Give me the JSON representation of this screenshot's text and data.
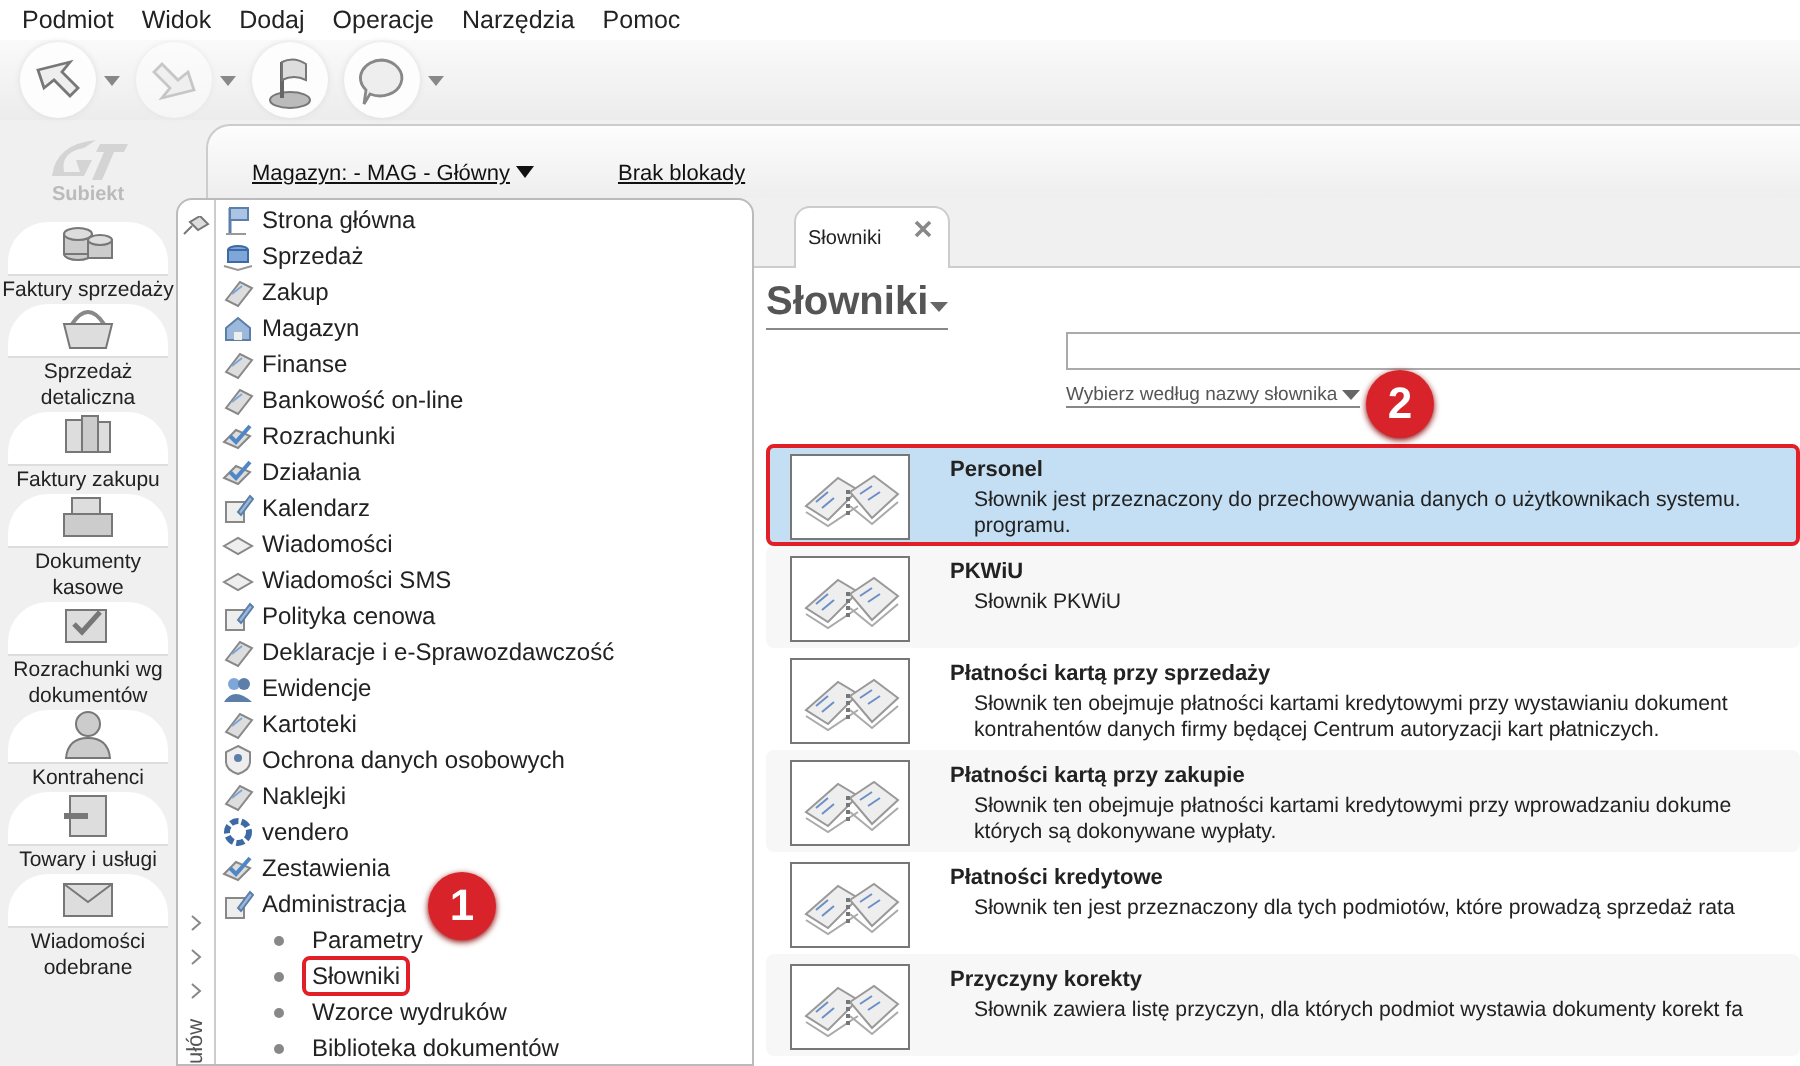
{
  "menu": [
    "Podmiot",
    "Widok",
    "Dodaj",
    "Operacje",
    "Narzędzia",
    "Pomoc"
  ],
  "toolbar": [
    {
      "has_menu": true,
      "disabled": false
    },
    {
      "has_menu": true,
      "disabled": true
    },
    {
      "has_menu": false,
      "disabled": false
    },
    {
      "has_menu": true,
      "disabled": false
    }
  ],
  "logo": {
    "text": "Subiekt"
  },
  "rail": [
    {
      "label": "Faktury sprzedaży"
    },
    {
      "label": "Sprzedaż detaliczna"
    },
    {
      "label": "Faktury zakupu"
    },
    {
      "label": "Dokumenty kasowe"
    },
    {
      "label": "Rozrachunki wg dokumentów"
    },
    {
      "label": "Kontrahenci"
    },
    {
      "label": "Towary i usługi"
    },
    {
      "label": "Wiadomości odebrane"
    }
  ],
  "header": {
    "warehouse": "Magazyn: - MAG - Główny",
    "lock": "Brak blokady"
  },
  "collapsed_label": "ułów",
  "nav": [
    {
      "label": "Strona główna"
    },
    {
      "label": "Sprzedaż"
    },
    {
      "label": "Zakup"
    },
    {
      "label": "Magazyn"
    },
    {
      "label": "Finanse"
    },
    {
      "label": "Bankowość on-line"
    },
    {
      "label": "Rozrachunki"
    },
    {
      "label": "Działania"
    },
    {
      "label": "Kalendarz"
    },
    {
      "label": "Wiadomości"
    },
    {
      "label": "Wiadomości SMS"
    },
    {
      "label": "Polityka cenowa"
    },
    {
      "label": "Deklaracje i e-Sprawozdawczość"
    },
    {
      "label": "Ewidencje"
    },
    {
      "label": "Kartoteki"
    },
    {
      "label": "Ochrona danych osobowych"
    },
    {
      "label": "Naklejki"
    },
    {
      "label": "vendero"
    },
    {
      "label": "Zestawienia"
    },
    {
      "label": "Administracja",
      "children": [
        {
          "label": "Parametry",
          "highlighted": false
        },
        {
          "label": "Słowniki",
          "highlighted": true
        },
        {
          "label": "Wzorce wydruków",
          "highlighted": false
        },
        {
          "label": "Biblioteka dokumentów",
          "highlighted": false
        }
      ]
    }
  ],
  "tabs": [
    {
      "label": "Słowniki",
      "selected": true
    }
  ],
  "page": {
    "title": "Słowniki",
    "filter": "Wybierz według nazwy słownika"
  },
  "rows": [
    {
      "name": "Personel",
      "lines": [
        "Słownik jest przeznaczony do przechowywania danych o użytkownikach systemu.",
        "programu."
      ],
      "selected": true,
      "highlighted": true
    },
    {
      "name": "PKWiU",
      "lines": [
        "Słownik PKWiU"
      ],
      "selected": false,
      "highlighted": false
    },
    {
      "name": "Płatności kartą przy sprzedaży",
      "lines": [
        "Słownik ten obejmuje płatności kartami kredytowymi przy wystawianiu dokument",
        "kontrahentów danych firmy będącej Centrum autoryzacji kart płatniczych."
      ],
      "selected": false,
      "highlighted": false
    },
    {
      "name": "Płatności kartą przy zakupie",
      "lines": [
        "Słownik ten obejmuje płatności kartami kredytowymi przy wprowadzaniu dokume",
        "których są dokonywane wypłaty."
      ],
      "selected": false,
      "highlighted": false
    },
    {
      "name": "Płatności kredytowe",
      "lines": [
        "Słownik ten jest przeznaczony dla tych podmiotów, które prowadzą sprzedaż rata"
      ],
      "selected": false,
      "highlighted": false
    },
    {
      "name": "Przyczyny korekty",
      "lines": [
        "Słownik zawiera listę przyczyn, dla których podmiot wystawia dokumenty korekt fa"
      ],
      "selected": false,
      "highlighted": false
    }
  ],
  "badges": [
    {
      "text": "1"
    },
    {
      "text": "2"
    }
  ]
}
